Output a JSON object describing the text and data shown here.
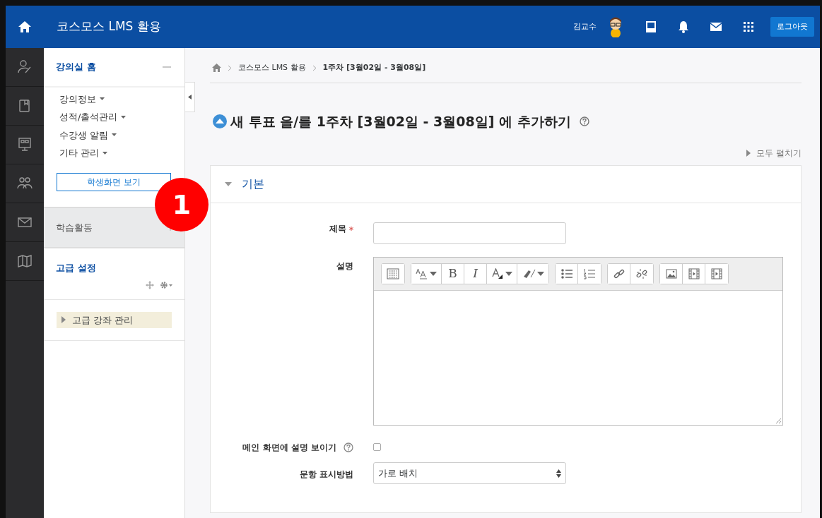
{
  "navbar": {
    "title": "코스모스 LMS 활용",
    "user_name": "김교수",
    "logout": "로그아웃"
  },
  "rail": [
    {
      "kind": "teacher"
    },
    {
      "kind": "book"
    },
    {
      "kind": "board"
    },
    {
      "kind": "people"
    },
    {
      "kind": "mail"
    },
    {
      "kind": "map"
    }
  ],
  "sidebar": {
    "home": {
      "label": "강의실 홈",
      "expanded": true
    },
    "menu": [
      {
        "label": "강의정보"
      },
      {
        "label": "성적/출석관리"
      },
      {
        "label": "수강생 알림"
      },
      {
        "label": "기타 관리"
      }
    ],
    "student_view_button": "학생화면 보기",
    "activity_section": "학습활동",
    "advanced": {
      "title": "고급 설정"
    },
    "tree": [
      {
        "label": "고급 강좌 관리",
        "expanded": false,
        "selected": true
      }
    ]
  },
  "annotation": "1",
  "breadcrumb": [
    "코스모스 LMS 활용",
    "1주차 [3월02일 - 3월08일]"
  ],
  "page_title": "새 투표 을/를 1주차 [3월02일 - 3월08일] 에 추가하기",
  "expand_all": "모두 펼치기",
  "fieldset": {
    "legend": "기본",
    "expanded": true
  },
  "form": {
    "title_label": "제목",
    "title_required": true,
    "description_label": "설명",
    "toolbar": [
      [
        {
          "kind": "keyboard"
        }
      ],
      [
        {
          "kind": "font-size",
          "dropdown": true
        },
        {
          "kind": "bold",
          "label": "B"
        },
        {
          "kind": "italic",
          "label": "I"
        },
        {
          "kind": "font-color",
          "dropdown": true
        },
        {
          "kind": "highlight",
          "dropdown": true
        }
      ],
      [
        {
          "kind": "bullet-list"
        },
        {
          "kind": "numbered-list"
        }
      ],
      [
        {
          "kind": "link"
        },
        {
          "kind": "unlink"
        }
      ],
      [
        {
          "kind": "image"
        },
        {
          "kind": "media"
        },
        {
          "kind": "video"
        }
      ]
    ],
    "show_description_label": "메인 화면에 설명 보이기",
    "show_description_checked": false,
    "display_label": "문항 표시방법",
    "display_value": "가로 배치"
  }
}
